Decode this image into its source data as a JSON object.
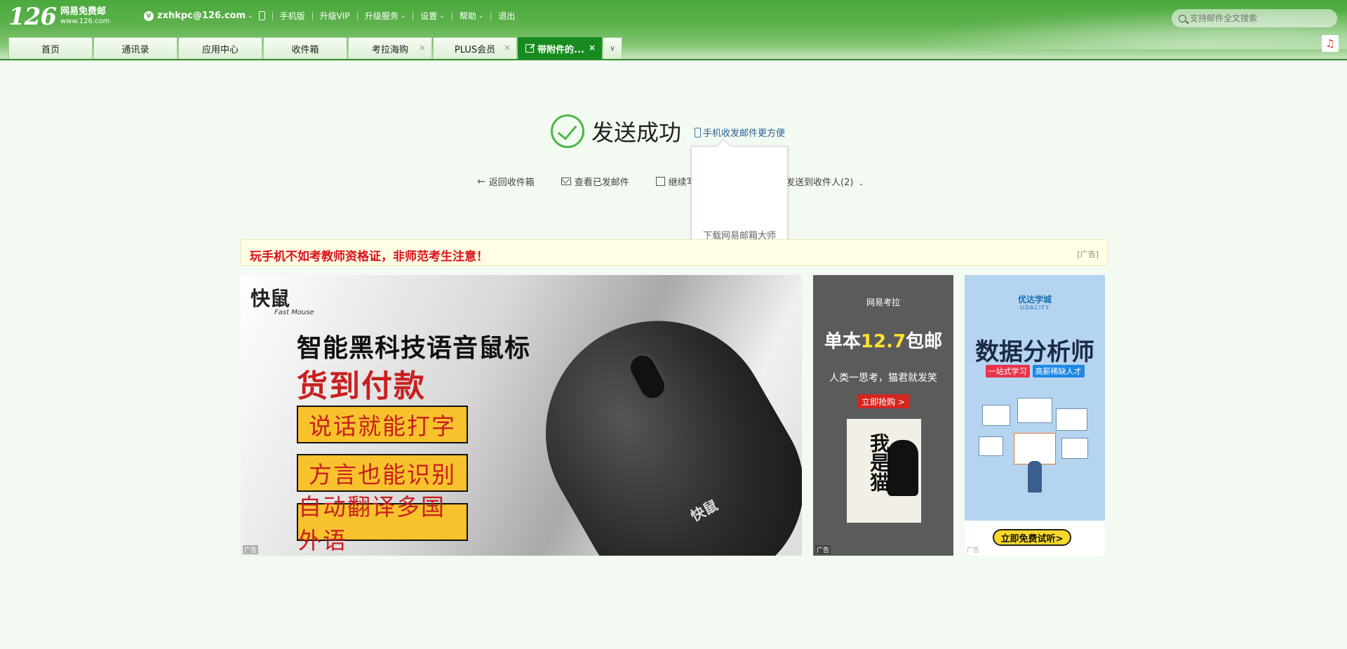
{
  "logo": {
    "number": "126",
    "name": "网易免费邮",
    "url": "www.126.com"
  },
  "topbar": {
    "avatar_letter": "V",
    "account": "zxhkpc@126.com",
    "links": [
      "手机版",
      "升级VIP",
      "升级服务",
      "设置",
      "帮助",
      "退出"
    ]
  },
  "search": {
    "placeholder": "支持邮件全文搜索"
  },
  "tabs": [
    {
      "label": "首页",
      "closable": false
    },
    {
      "label": "通讯录",
      "closable": false
    },
    {
      "label": "应用中心",
      "closable": false
    },
    {
      "label": "收件箱",
      "closable": false
    },
    {
      "label": "考拉海购",
      "closable": true
    },
    {
      "label": "PLUS会员",
      "closable": true
    },
    {
      "label": "带附件的...",
      "closable": true,
      "active": true
    }
  ],
  "result": {
    "title": "发送成功",
    "mobile_link": "手机收发邮件更方便",
    "popup_text": "下载网易邮箱大师",
    "actions": [
      "返回收件箱",
      "查看已发邮件",
      "继续写信"
    ],
    "send_to": "发送到收件人(2)"
  },
  "adbar": {
    "text": "玩手机不如考教师资格证，非师范考生注意！",
    "tag": "[广告]"
  },
  "ad_mouse": {
    "brand": "快鼠",
    "brand_sub": "Fast Mouse",
    "title": "智能黑科技语音鼠标",
    "red_text": "货到付款",
    "boxes": [
      "说话就能打字",
      "方言也能识别",
      "自动翻译多国外语"
    ],
    "mark": "广告"
  },
  "ad_kaola": {
    "logo": "网易考拉",
    "price_prefix": "单本",
    "price": "12.7",
    "price_suffix": "包邮",
    "subtitle": "人类一思考，猫君就发笑",
    "button": "立即抢购 >",
    "book_title": "我是猫",
    "mark": "广告"
  },
  "ad_udacity": {
    "logo": "优达学城",
    "logo_sub": "UDACITY",
    "title": "数据分析师",
    "tag1": "一站式学习",
    "tag2": "高薪稀缺人才",
    "button": "立即免费试听>",
    "mark": "广告",
    "colors": {
      "tag1": "#e8334a",
      "tag2": "#1e88e5"
    }
  },
  "colors": {
    "accent": "#178b1d",
    "header": "#4aa93c",
    "ad_red": "#d8121b"
  }
}
